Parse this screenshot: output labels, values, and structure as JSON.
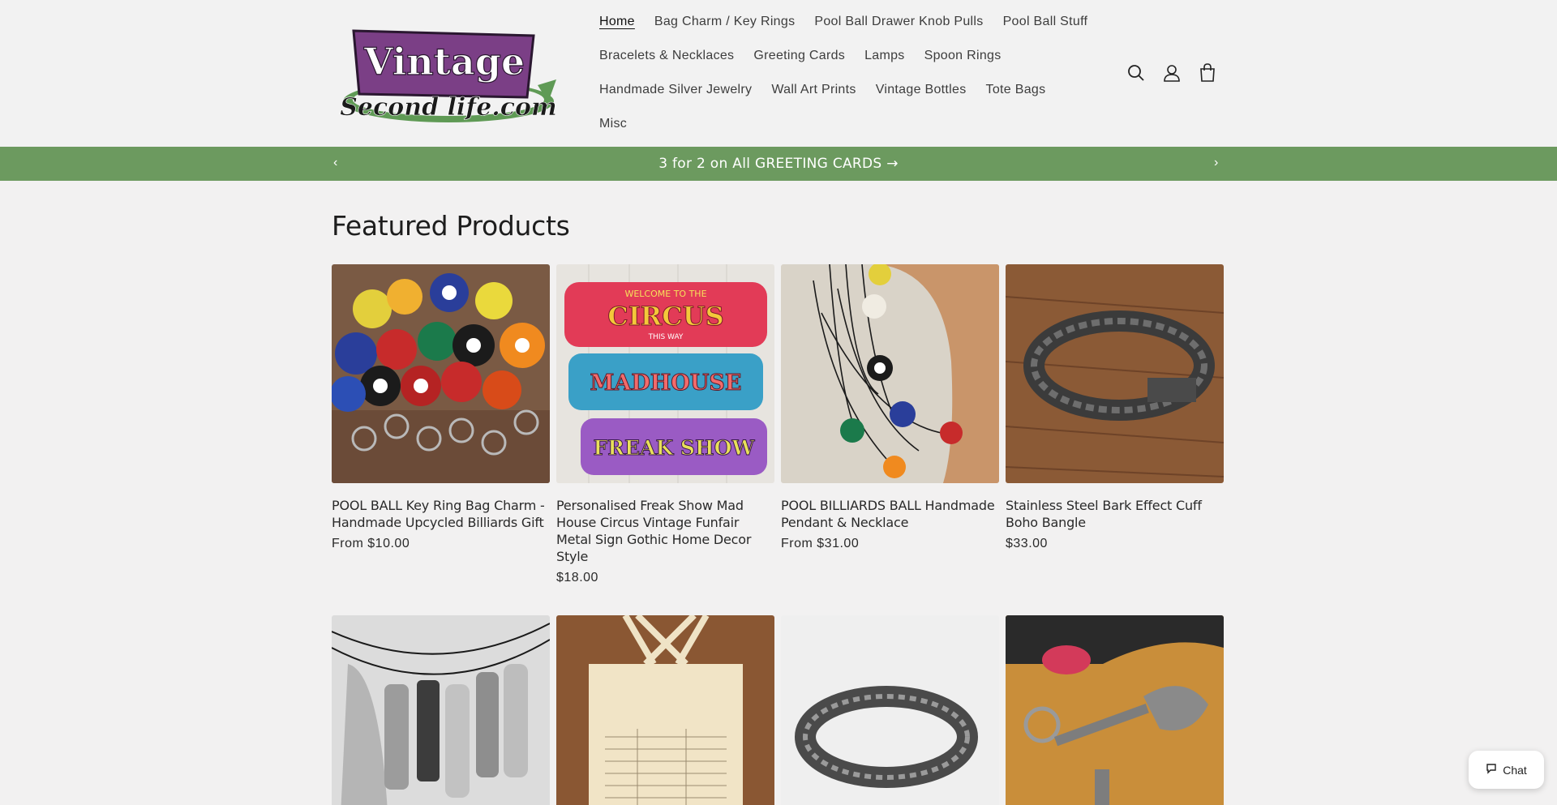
{
  "brand": {
    "logo_text_1": "Vintage",
    "logo_text_2": "Second life.com"
  },
  "nav": {
    "rows": [
      [
        "Home",
        "Bag Charm / Key Rings",
        "Pool Ball Drawer Knob Pulls",
        "Pool Ball Stuff"
      ],
      [
        "Bracelets & Necklaces",
        "Greeting Cards",
        "Lamps",
        "Spoon Rings"
      ],
      [
        "Handmade Silver Jewelry",
        "Wall Art Prints",
        "Vintage Bottles",
        "Tote Bags"
      ],
      [
        "Misc"
      ]
    ],
    "active": "Home"
  },
  "header_icons": [
    "search-icon",
    "account-icon",
    "cart-icon"
  ],
  "announcement": {
    "text": "3 for 2 on All GREETING CARDS",
    "arrow": "→",
    "prev": "‹",
    "next": "›"
  },
  "section": {
    "title": "Featured Products"
  },
  "products": [
    {
      "title": "POOL BALL Key Ring Bag Charm - Handmade Upcycled Billiards Gift",
      "price": "From $10.00"
    },
    {
      "title": "Personalised Freak Show Mad House Circus Vintage Funfair Metal Sign Gothic Home Decor Style",
      "price": "$18.00"
    },
    {
      "title": "POOL BILLIARDS BALL Handmade Pendant & Necklace",
      "price": "From $31.00"
    },
    {
      "title": "Stainless Steel Bark Effect Cuff Boho Bangle",
      "price": "$33.00"
    }
  ],
  "circus_sign": {
    "line1": "WELCOME TO THE",
    "word1": "CIRCUS",
    "line2": "THIS WAY",
    "word2": "MADHOUSE",
    "word3": "FREAK SHOW"
  },
  "chat": {
    "label": "Chat"
  },
  "colors": {
    "announcement_bg": "#6c9a5f",
    "logo_purple": "#7b3f86",
    "logo_green": "#5f9a55"
  }
}
